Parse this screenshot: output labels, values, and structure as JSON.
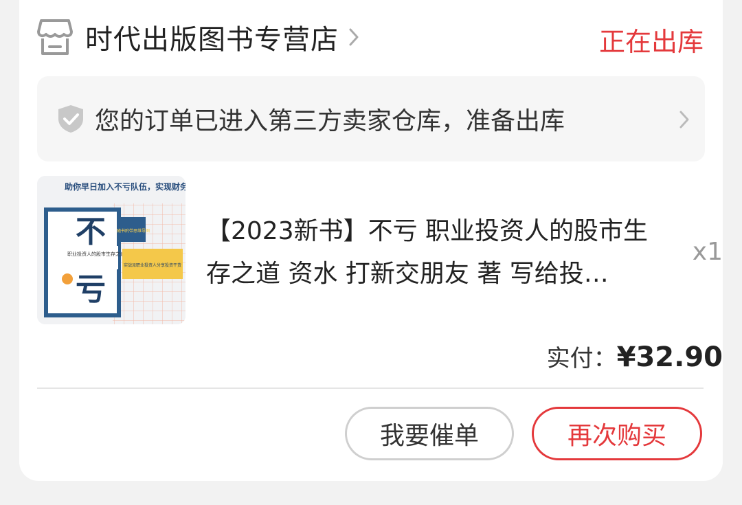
{
  "store": {
    "name": "时代出版图书专营店",
    "status": "正在出库"
  },
  "notice": {
    "text": "您的订单已进入第三方卖家仓库，准备出库"
  },
  "product": {
    "title": "【2023新书】不亏 职业投资人的股市生存之道 资水 打新交朋友 著 写给投…",
    "quantity": "x1",
    "cover": {
      "banner": "助你早日加入不亏队伍，实现财务自由！",
      "big_char_1": "不",
      "big_char_2": "亏",
      "subtitle": "职业投资人的股市生存之道",
      "tag": "随书附带思维导图",
      "slogan": "实战派职业投资人分享投资干货"
    }
  },
  "payment": {
    "label": "实付：",
    "amount": "¥32.90"
  },
  "actions": {
    "urge_label": "我要催单",
    "rebuy_label": "再次购买"
  },
  "colors": {
    "accent": "#e4393c",
    "text": "#222222",
    "muted": "#999999"
  }
}
